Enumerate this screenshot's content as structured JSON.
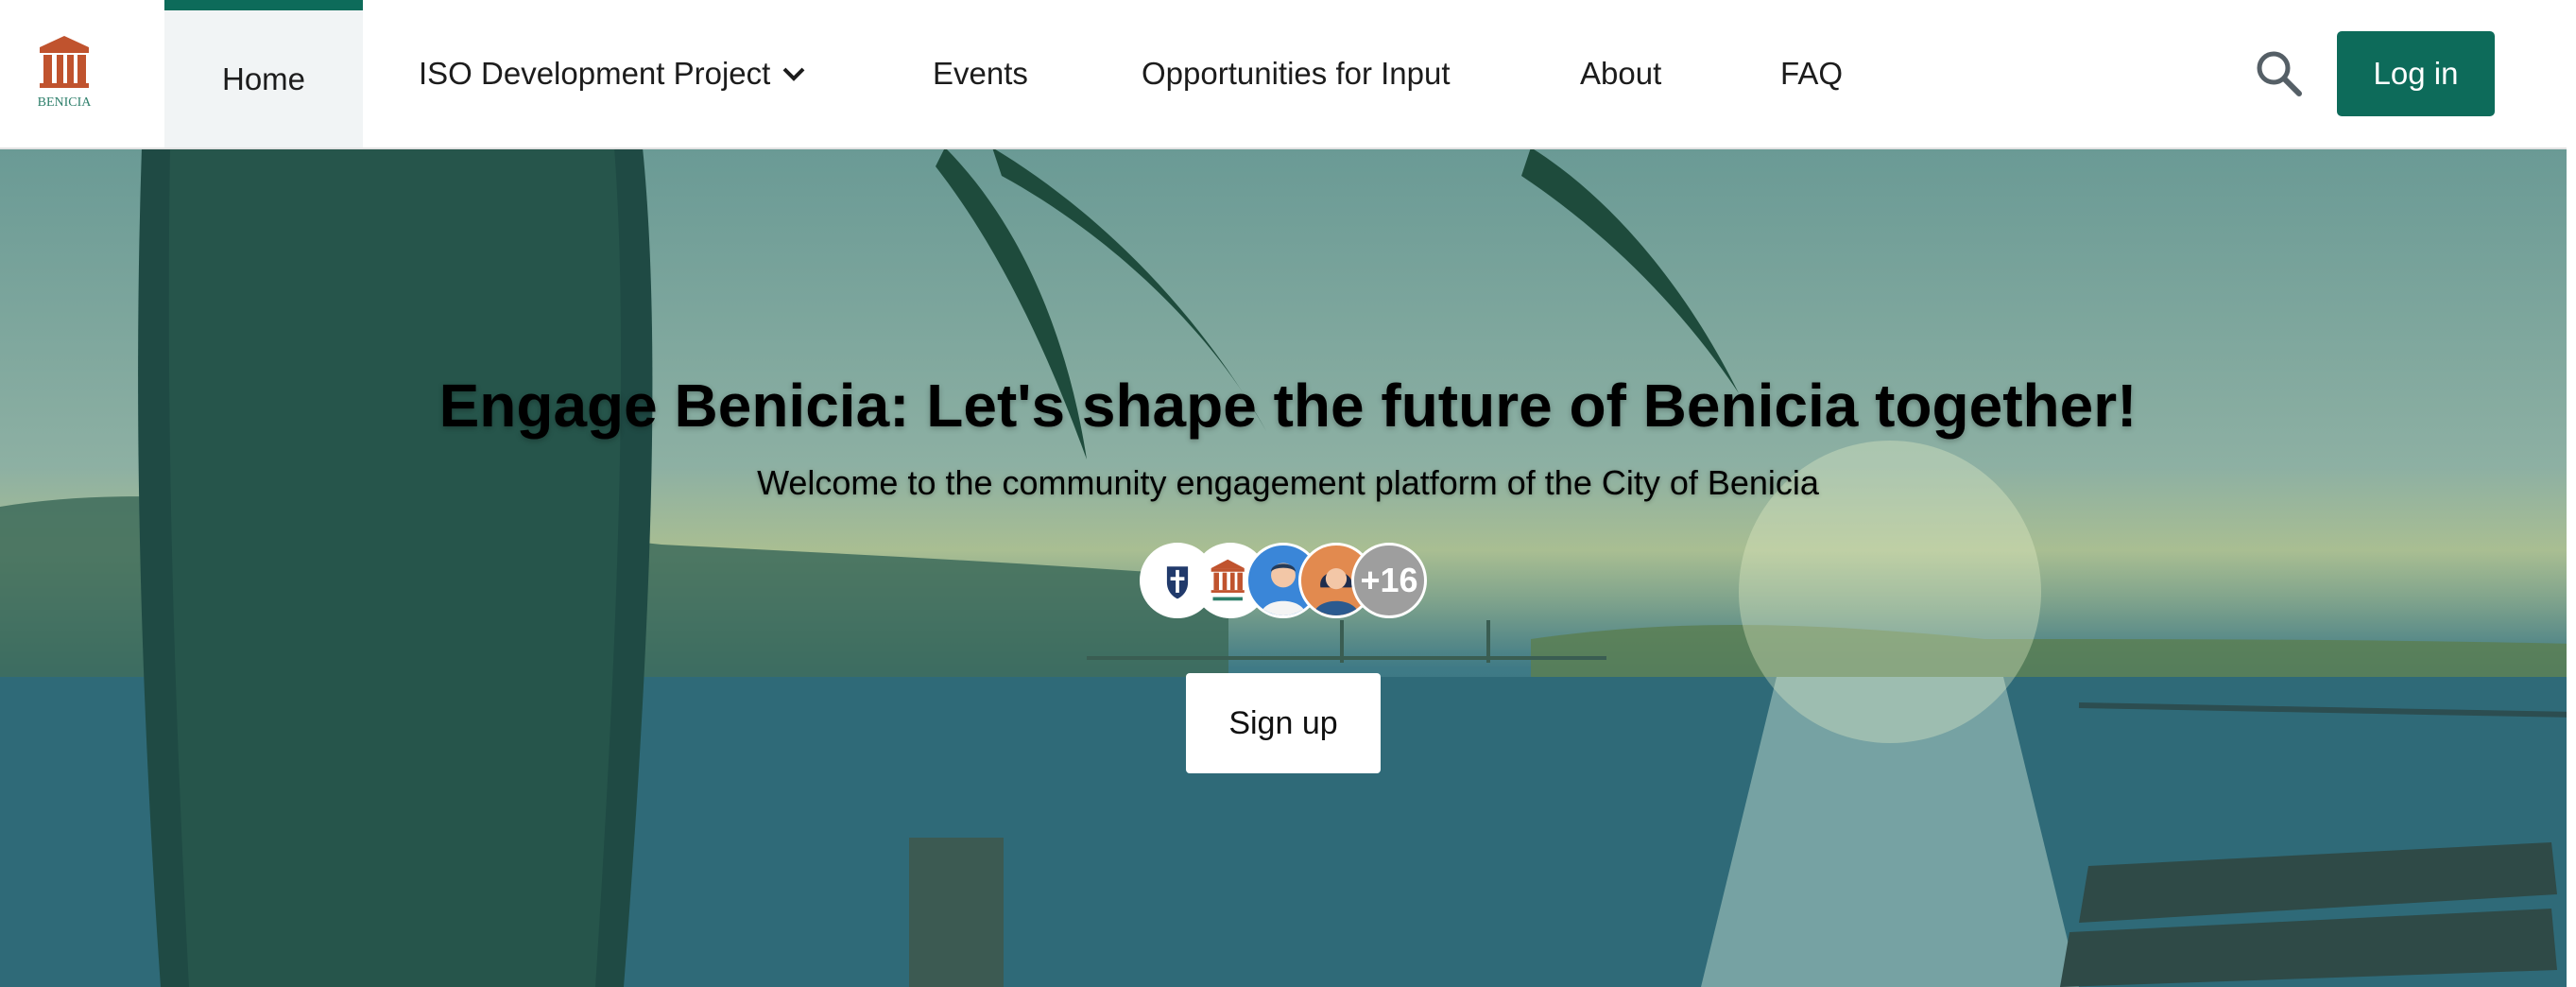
{
  "nav": {
    "logo_label": "BENICIA",
    "items": [
      {
        "label": "Home",
        "active": true
      },
      {
        "label": "ISO Development Project",
        "has_dropdown": true
      },
      {
        "label": "Events"
      },
      {
        "label": "Opportunities for Input"
      },
      {
        "label": "About"
      },
      {
        "label": "FAQ"
      }
    ],
    "search_icon": "search-icon",
    "login_label": "Log in"
  },
  "hero": {
    "title": "Engage Benicia: Let's shape the future of Benicia together!",
    "subtitle": "Welcome to the community engagement platform of the City of Benicia",
    "avatars_more": "+16",
    "signup_label": "Sign up"
  },
  "colors": {
    "brand": "#0d6b5a",
    "logo": "#c0532e"
  }
}
